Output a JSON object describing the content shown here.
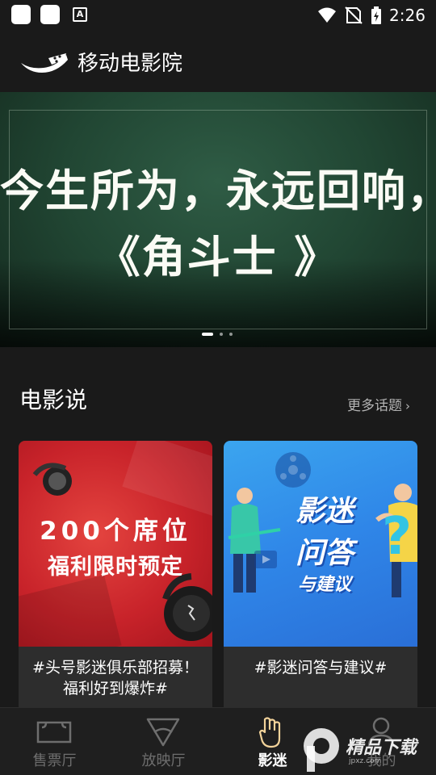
{
  "status_bar": {
    "time": "2:26",
    "a_icon_letter": "A",
    "icons": [
      "notification-square-icon",
      "notification-square-icon",
      "a-icon",
      "wifi-icon",
      "no-sim-icon",
      "battery-charging-icon"
    ]
  },
  "app_bar": {
    "title": "移动电影院",
    "logo_icon": "film-reel-logo-icon"
  },
  "banner": {
    "line1": "今生所为，永远回响，",
    "line2": "《角斗士 》",
    "slide_count": 3,
    "active_slide": 1
  },
  "section": {
    "title": "电影说",
    "more_label": "更多话题",
    "more_icon": "chevron-right-icon"
  },
  "cards": [
    {
      "image_line1": "200个席位",
      "image_line2": "福利限时预定",
      "caption": "#头号影迷俱乐部招募！福利好到爆炸#",
      "image_icon": "headphones-icon"
    },
    {
      "image_line1": "影迷",
      "image_line2": "问答",
      "image_line3": "与建议",
      "caption": "#影迷问答与建议#",
      "image_icon": "film-reel-icon"
    }
  ],
  "bottom_nav": {
    "items": [
      {
        "label": "售票厅",
        "icon": "ticket-icon",
        "active": false
      },
      {
        "label": "放映厅",
        "icon": "projector-triangle-icon",
        "active": false
      },
      {
        "label": "影迷",
        "icon": "hand-rock-icon",
        "active": true
      },
      {
        "label": "我的",
        "icon": "user-icon",
        "active": false
      }
    ]
  },
  "watermark": {
    "text": "精品下载",
    "sub": "jpxz.com"
  },
  "colors": {
    "background": "#1a1a1a",
    "card_background": "#2d2d2d",
    "nav_active": "#ffffff",
    "nav_inactive": "#6e6e6e",
    "banner_green": "#2f5c45",
    "card1_red": "#c8232a",
    "card2_blue": "#2f86e8"
  }
}
